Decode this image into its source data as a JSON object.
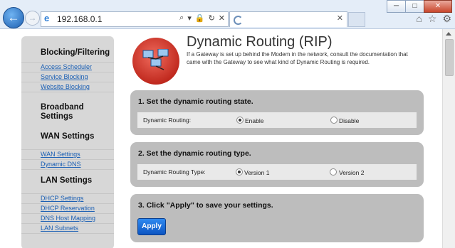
{
  "browser": {
    "url": "192.168.0.1",
    "window_buttons": [
      "─",
      "□",
      "✕"
    ],
    "back_glyph": "←",
    "forward_glyph": "→",
    "addr_tools": [
      "⌕",
      "▾",
      "🔒",
      "↻",
      "✕"
    ],
    "tab_close": "✕",
    "right_tools": [
      "⌂",
      "☆",
      "⚙"
    ]
  },
  "sidebar": {
    "sections": [
      {
        "title": "Blocking/Filtering",
        "links": [
          "Access Scheduler",
          "Service Blocking",
          "Website Blocking"
        ]
      },
      {
        "title": "Broadband Settings",
        "links": []
      },
      {
        "title": "WAN Settings",
        "links": [
          "WAN Settings",
          "Dynamic DNS"
        ]
      },
      {
        "title": "LAN Settings",
        "links": [
          "DHCP Settings",
          "DHCP Reservation",
          "DNS Host Mapping",
          "LAN Subnets"
        ]
      }
    ]
  },
  "header": {
    "title": "Dynamic Routing (RIP)",
    "description": "If a Gateway is set up behind the Modem in the network, consult the documentation that came with the Gateway to see what kind of Dynamic Routing is required."
  },
  "panels": [
    {
      "title": "1. Set the dynamic routing state.",
      "label": "Dynamic Routing:",
      "options": [
        "Enable",
        "Disable"
      ],
      "selected": 0
    },
    {
      "title": "2. Set the dynamic routing type.",
      "label": "Dynamic Routing Type:",
      "options": [
        "Version 1",
        "Version 2"
      ],
      "selected": 0
    },
    {
      "title": "3. Click \"Apply\" to save your settings.",
      "button": "Apply"
    }
  ]
}
